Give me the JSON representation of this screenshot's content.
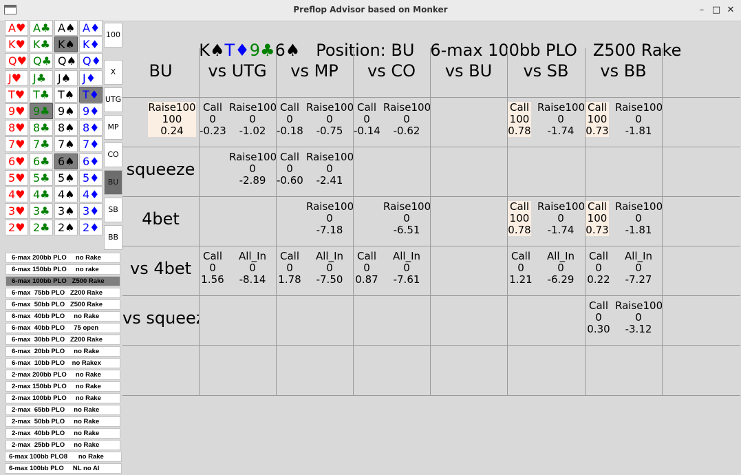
{
  "window": {
    "title": "Preflop Advisor based on Monker",
    "buttons": [
      "–",
      "□",
      "✕"
    ]
  },
  "header_text": "K♠T♦9♣6♠   Position: BU   6-max 100bb PLO   Z500 Rake",
  "hand": [
    {
      "rank": "K",
      "suit": "♠",
      "color": "#000000"
    },
    {
      "rank": "T",
      "suit": "♦",
      "color": "#0000ff"
    },
    {
      "rank": "9",
      "suit": "♣",
      "color": "#008000"
    },
    {
      "rank": "6",
      "suit": "♠",
      "color": "#000000"
    }
  ],
  "header": {
    "position_label": "Position: BU",
    "game": "6-max 100bb PLO",
    "rake": "Z500 Rake"
  },
  "cards": {
    "ranks": [
      "A",
      "K",
      "Q",
      "J",
      "T",
      "9",
      "8",
      "7",
      "6",
      "5",
      "4",
      "3",
      "2"
    ],
    "suits": [
      {
        "sym": "♥",
        "color": "#ff0000"
      },
      {
        "sym": "♣",
        "color": "#008000"
      },
      {
        "sym": "♠",
        "color": "#000000"
      },
      {
        "sym": "♦",
        "color": "#0000ff"
      }
    ],
    "selected": [
      "K♠",
      "T♦",
      "9♣",
      "6♠"
    ]
  },
  "positions": [
    "100",
    "X",
    "UTG",
    "MP",
    "CO",
    "BU",
    "SB",
    "BB"
  ],
  "selected_position": "BU",
  "configs": [
    "6-max 200bb PLO     no Rake",
    "6-max 150bb PLO     no rake",
    "6-max 100bb PLO   Z500 Rake",
    "6-max  75bb PLO   Z200 Rake",
    "6-max  50bb PLO   Z500 Rake",
    "6-max  40bb PLO     no Rake",
    "6-max  40bb PLO     75 open",
    "6-max  30bb PLO   Z200 Rake",
    "6-max  20bb PLO     no Rake",
    "6-max  10bb PLO    no Rakex",
    "2-max 200bb PLO     no Rake",
    "2-max 150bb PLO     no Rake",
    "2-max 100bb PLO     no Rake",
    "2-max  65bb PLO     no Rake",
    "2-max  50bb PLO     no Rake",
    "2-max  40bb PLO     no Rake",
    "2-max  25bb PLO     no Rake",
    "6-max 100bb PLO8      no Rake",
    "6-max 100bb PLO     NL no AI"
  ],
  "selected_config": 2,
  "table": {
    "columns": [
      "BU",
      "vs UTG",
      "vs MP",
      "vs CO",
      "vs BU",
      "vs SB",
      "vs BB"
    ],
    "rows": [
      {
        "label": "",
        "cells": [
          [
            {
              "a": "Raise100",
              "b": "100",
              "c": "0.24",
              "hl": true
            }
          ],
          [
            {
              "a": "Call",
              "b": "0",
              "c": "-0.23"
            },
            {
              "a": "Raise100",
              "b": "0",
              "c": "-1.02"
            }
          ],
          [
            {
              "a": "Call",
              "b": "0",
              "c": "-0.18"
            },
            {
              "a": "Raise100",
              "b": "0",
              "c": "-0.75"
            }
          ],
          [
            {
              "a": "Call",
              "b": "0",
              "c": "-0.14"
            },
            {
              "a": "Raise100",
              "b": "0",
              "c": "-0.62"
            }
          ],
          [],
          [
            {
              "a": "Call",
              "b": "100",
              "c": "0.78",
              "hl": true
            },
            {
              "a": "Raise100",
              "b": "0",
              "c": "-1.74"
            }
          ],
          [
            {
              "a": "Call",
              "b": "100",
              "c": "0.73",
              "hl": true
            },
            {
              "a": "Raise100",
              "b": "0",
              "c": "-1.81"
            }
          ]
        ]
      },
      {
        "label": "squeeze",
        "cells": [
          [],
          [
            {
              "a": "",
              "b": "",
              "c": ""
            },
            {
              "a": "Raise100",
              "b": "0",
              "c": "-2.89"
            }
          ],
          [
            {
              "a": "Call",
              "b": "0",
              "c": "-0.60"
            },
            {
              "a": "Raise100",
              "b": "0",
              "c": "-2.41"
            }
          ],
          [],
          [],
          [],
          []
        ]
      },
      {
        "label": "4bet",
        "cells": [
          [],
          [],
          [
            {
              "a": "",
              "b": "",
              "c": ""
            },
            {
              "a": "Raise100",
              "b": "0",
              "c": "-7.18"
            }
          ],
          [
            {
              "a": "",
              "b": "",
              "c": ""
            },
            {
              "a": "Raise100",
              "b": "0",
              "c": "-6.51"
            }
          ],
          [],
          [
            {
              "a": "Call",
              "b": "100",
              "c": "0.78",
              "hl": true
            },
            {
              "a": "Raise100",
              "b": "0",
              "c": "-1.74"
            }
          ],
          [
            {
              "a": "Call",
              "b": "100",
              "c": "0.73",
              "hl": true
            },
            {
              "a": "Raise100",
              "b": "0",
              "c": "-1.81"
            }
          ]
        ]
      },
      {
        "label": "vs 4bet",
        "cells": [
          [],
          [
            {
              "a": "Call",
              "b": "0",
              "c": "1.56"
            },
            {
              "a": "All_In",
              "b": "0",
              "c": "-8.14"
            }
          ],
          [
            {
              "a": "Call",
              "b": "0",
              "c": "1.78"
            },
            {
              "a": "All_In",
              "b": "0",
              "c": "-7.50"
            }
          ],
          [
            {
              "a": "Call",
              "b": "0",
              "c": "0.87"
            },
            {
              "a": "All_In",
              "b": "0",
              "c": "-7.61"
            }
          ],
          [],
          [
            {
              "a": "Call",
              "b": "0",
              "c": "1.21"
            },
            {
              "a": "All_In",
              "b": "0",
              "c": "-6.29"
            }
          ],
          [
            {
              "a": "Call",
              "b": "0",
              "c": "0.22"
            },
            {
              "a": "All_In",
              "b": "0",
              "c": "-7.27"
            }
          ]
        ]
      },
      {
        "label": "vs squeeze",
        "cells": [
          [],
          [],
          [],
          [],
          [],
          [],
          [
            {
              "a": "Call",
              "b": "0",
              "c": "0.30"
            },
            {
              "a": "Raise100",
              "b": "0",
              "c": "-3.12"
            }
          ]
        ]
      },
      {
        "label": "",
        "cells": [
          [],
          [],
          [],
          [],
          [],
          [],
          []
        ]
      }
    ]
  }
}
